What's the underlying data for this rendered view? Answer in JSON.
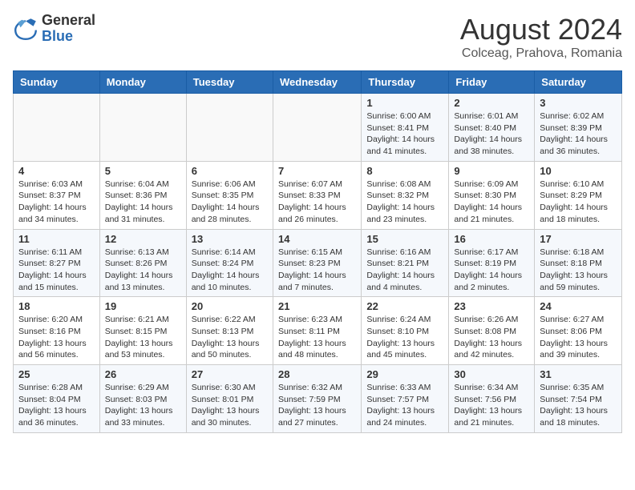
{
  "logo": {
    "general": "General",
    "blue": "Blue"
  },
  "title": "August 2024",
  "subtitle": "Colceag, Prahova, Romania",
  "days_of_week": [
    "Sunday",
    "Monday",
    "Tuesday",
    "Wednesday",
    "Thursday",
    "Friday",
    "Saturday"
  ],
  "weeks": [
    [
      {
        "day": "",
        "info": ""
      },
      {
        "day": "",
        "info": ""
      },
      {
        "day": "",
        "info": ""
      },
      {
        "day": "",
        "info": ""
      },
      {
        "day": "1",
        "info": "Sunrise: 6:00 AM\nSunset: 8:41 PM\nDaylight: 14 hours\nand 41 minutes."
      },
      {
        "day": "2",
        "info": "Sunrise: 6:01 AM\nSunset: 8:40 PM\nDaylight: 14 hours\nand 38 minutes."
      },
      {
        "day": "3",
        "info": "Sunrise: 6:02 AM\nSunset: 8:39 PM\nDaylight: 14 hours\nand 36 minutes."
      }
    ],
    [
      {
        "day": "4",
        "info": "Sunrise: 6:03 AM\nSunset: 8:37 PM\nDaylight: 14 hours\nand 34 minutes."
      },
      {
        "day": "5",
        "info": "Sunrise: 6:04 AM\nSunset: 8:36 PM\nDaylight: 14 hours\nand 31 minutes."
      },
      {
        "day": "6",
        "info": "Sunrise: 6:06 AM\nSunset: 8:35 PM\nDaylight: 14 hours\nand 28 minutes."
      },
      {
        "day": "7",
        "info": "Sunrise: 6:07 AM\nSunset: 8:33 PM\nDaylight: 14 hours\nand 26 minutes."
      },
      {
        "day": "8",
        "info": "Sunrise: 6:08 AM\nSunset: 8:32 PM\nDaylight: 14 hours\nand 23 minutes."
      },
      {
        "day": "9",
        "info": "Sunrise: 6:09 AM\nSunset: 8:30 PM\nDaylight: 14 hours\nand 21 minutes."
      },
      {
        "day": "10",
        "info": "Sunrise: 6:10 AM\nSunset: 8:29 PM\nDaylight: 14 hours\nand 18 minutes."
      }
    ],
    [
      {
        "day": "11",
        "info": "Sunrise: 6:11 AM\nSunset: 8:27 PM\nDaylight: 14 hours\nand 15 minutes."
      },
      {
        "day": "12",
        "info": "Sunrise: 6:13 AM\nSunset: 8:26 PM\nDaylight: 14 hours\nand 13 minutes."
      },
      {
        "day": "13",
        "info": "Sunrise: 6:14 AM\nSunset: 8:24 PM\nDaylight: 14 hours\nand 10 minutes."
      },
      {
        "day": "14",
        "info": "Sunrise: 6:15 AM\nSunset: 8:23 PM\nDaylight: 14 hours\nand 7 minutes."
      },
      {
        "day": "15",
        "info": "Sunrise: 6:16 AM\nSunset: 8:21 PM\nDaylight: 14 hours\nand 4 minutes."
      },
      {
        "day": "16",
        "info": "Sunrise: 6:17 AM\nSunset: 8:19 PM\nDaylight: 14 hours\nand 2 minutes."
      },
      {
        "day": "17",
        "info": "Sunrise: 6:18 AM\nSunset: 8:18 PM\nDaylight: 13 hours\nand 59 minutes."
      }
    ],
    [
      {
        "day": "18",
        "info": "Sunrise: 6:20 AM\nSunset: 8:16 PM\nDaylight: 13 hours\nand 56 minutes."
      },
      {
        "day": "19",
        "info": "Sunrise: 6:21 AM\nSunset: 8:15 PM\nDaylight: 13 hours\nand 53 minutes."
      },
      {
        "day": "20",
        "info": "Sunrise: 6:22 AM\nSunset: 8:13 PM\nDaylight: 13 hours\nand 50 minutes."
      },
      {
        "day": "21",
        "info": "Sunrise: 6:23 AM\nSunset: 8:11 PM\nDaylight: 13 hours\nand 48 minutes."
      },
      {
        "day": "22",
        "info": "Sunrise: 6:24 AM\nSunset: 8:10 PM\nDaylight: 13 hours\nand 45 minutes."
      },
      {
        "day": "23",
        "info": "Sunrise: 6:26 AM\nSunset: 8:08 PM\nDaylight: 13 hours\nand 42 minutes."
      },
      {
        "day": "24",
        "info": "Sunrise: 6:27 AM\nSunset: 8:06 PM\nDaylight: 13 hours\nand 39 minutes."
      }
    ],
    [
      {
        "day": "25",
        "info": "Sunrise: 6:28 AM\nSunset: 8:04 PM\nDaylight: 13 hours\nand 36 minutes."
      },
      {
        "day": "26",
        "info": "Sunrise: 6:29 AM\nSunset: 8:03 PM\nDaylight: 13 hours\nand 33 minutes."
      },
      {
        "day": "27",
        "info": "Sunrise: 6:30 AM\nSunset: 8:01 PM\nDaylight: 13 hours\nand 30 minutes."
      },
      {
        "day": "28",
        "info": "Sunrise: 6:32 AM\nSunset: 7:59 PM\nDaylight: 13 hours\nand 27 minutes."
      },
      {
        "day": "29",
        "info": "Sunrise: 6:33 AM\nSunset: 7:57 PM\nDaylight: 13 hours\nand 24 minutes."
      },
      {
        "day": "30",
        "info": "Sunrise: 6:34 AM\nSunset: 7:56 PM\nDaylight: 13 hours\nand 21 minutes."
      },
      {
        "day": "31",
        "info": "Sunrise: 6:35 AM\nSunset: 7:54 PM\nDaylight: 13 hours\nand 18 minutes."
      }
    ]
  ]
}
